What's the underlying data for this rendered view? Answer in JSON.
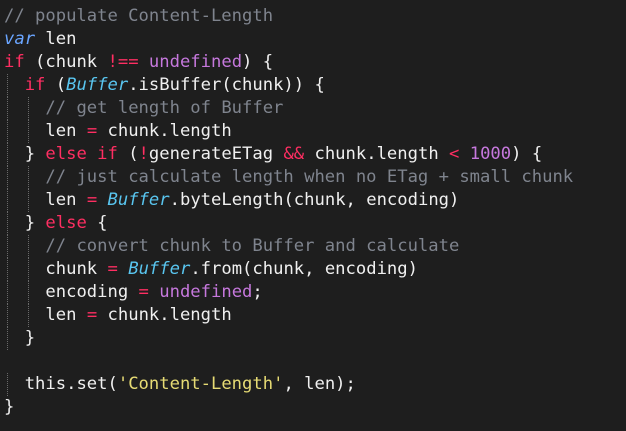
{
  "editor": {
    "background": "#1e1e1e",
    "lines": [
      {
        "indent": 0,
        "tokens": [
          {
            "t": "// populate Content-Length",
            "c": "c"
          }
        ]
      },
      {
        "indent": 0,
        "tokens": [
          {
            "t": "var",
            "c": "kb"
          },
          {
            "t": " len",
            "c": "p"
          }
        ]
      },
      {
        "indent": 0,
        "tokens": [
          {
            "t": "if",
            "c": "k"
          },
          {
            "t": " (chunk ",
            "c": "p"
          },
          {
            "t": "!==",
            "c": "op"
          },
          {
            "t": " ",
            "c": "p"
          },
          {
            "t": "undefined",
            "c": "pu"
          },
          {
            "t": ") {",
            "c": "p"
          }
        ]
      },
      {
        "indent": 1,
        "tokens": [
          {
            "t": "if",
            "c": "k"
          },
          {
            "t": " (",
            "c": "p"
          },
          {
            "t": "Buffer",
            "c": "ty"
          },
          {
            "t": ".isBuffer(chunk)) {",
            "c": "p"
          }
        ]
      },
      {
        "indent": 2,
        "tokens": [
          {
            "t": "// get length of Buffer",
            "c": "c"
          }
        ]
      },
      {
        "indent": 2,
        "tokens": [
          {
            "t": "len ",
            "c": "p"
          },
          {
            "t": "=",
            "c": "op"
          },
          {
            "t": " chunk.length",
            "c": "p"
          }
        ]
      },
      {
        "indent": 1,
        "tokens": [
          {
            "t": "} ",
            "c": "p"
          },
          {
            "t": "else if",
            "c": "k"
          },
          {
            "t": " (",
            "c": "p"
          },
          {
            "t": "!",
            "c": "op"
          },
          {
            "t": "generateETag ",
            "c": "p"
          },
          {
            "t": "&&",
            "c": "op"
          },
          {
            "t": " chunk.length ",
            "c": "p"
          },
          {
            "t": "<",
            "c": "op"
          },
          {
            "t": " ",
            "c": "p"
          },
          {
            "t": "1000",
            "c": "n"
          },
          {
            "t": ") {",
            "c": "p"
          }
        ]
      },
      {
        "indent": 2,
        "tokens": [
          {
            "t": "// just calculate length when no ETag + small chunk",
            "c": "c"
          }
        ]
      },
      {
        "indent": 2,
        "tokens": [
          {
            "t": "len ",
            "c": "p"
          },
          {
            "t": "=",
            "c": "op"
          },
          {
            "t": " ",
            "c": "p"
          },
          {
            "t": "Buffer",
            "c": "ty"
          },
          {
            "t": ".byteLength(chunk, encoding)",
            "c": "p"
          }
        ]
      },
      {
        "indent": 1,
        "tokens": [
          {
            "t": "} ",
            "c": "p"
          },
          {
            "t": "else",
            "c": "k"
          },
          {
            "t": " {",
            "c": "p"
          }
        ]
      },
      {
        "indent": 2,
        "tokens": [
          {
            "t": "// convert chunk to Buffer and calculate",
            "c": "c"
          }
        ]
      },
      {
        "indent": 2,
        "tokens": [
          {
            "t": "chunk ",
            "c": "p"
          },
          {
            "t": "=",
            "c": "op"
          },
          {
            "t": " ",
            "c": "p"
          },
          {
            "t": "Buffer",
            "c": "ty"
          },
          {
            "t": ".from(chunk, encoding)",
            "c": "p"
          }
        ]
      },
      {
        "indent": 2,
        "tokens": [
          {
            "t": "encoding ",
            "c": "p"
          },
          {
            "t": "=",
            "c": "op"
          },
          {
            "t": " ",
            "c": "p"
          },
          {
            "t": "undefined",
            "c": "pu"
          },
          {
            "t": ";",
            "c": "p"
          }
        ]
      },
      {
        "indent": 2,
        "tokens": [
          {
            "t": "len ",
            "c": "p"
          },
          {
            "t": "=",
            "c": "op"
          },
          {
            "t": " chunk.length",
            "c": "p"
          }
        ]
      },
      {
        "indent": 1,
        "tokens": [
          {
            "t": "}",
            "c": "p"
          }
        ]
      },
      {
        "indent": 0,
        "tokens": []
      },
      {
        "indent": 1,
        "tokens": [
          {
            "t": "this",
            "c": "p"
          },
          {
            "t": ".set(",
            "c": "p"
          },
          {
            "t": "'Content-Length'",
            "c": "s"
          },
          {
            "t": ", len);",
            "c": "p"
          }
        ]
      },
      {
        "indent": 0,
        "tokens": [
          {
            "t": "}",
            "c": "p"
          }
        ]
      }
    ]
  }
}
